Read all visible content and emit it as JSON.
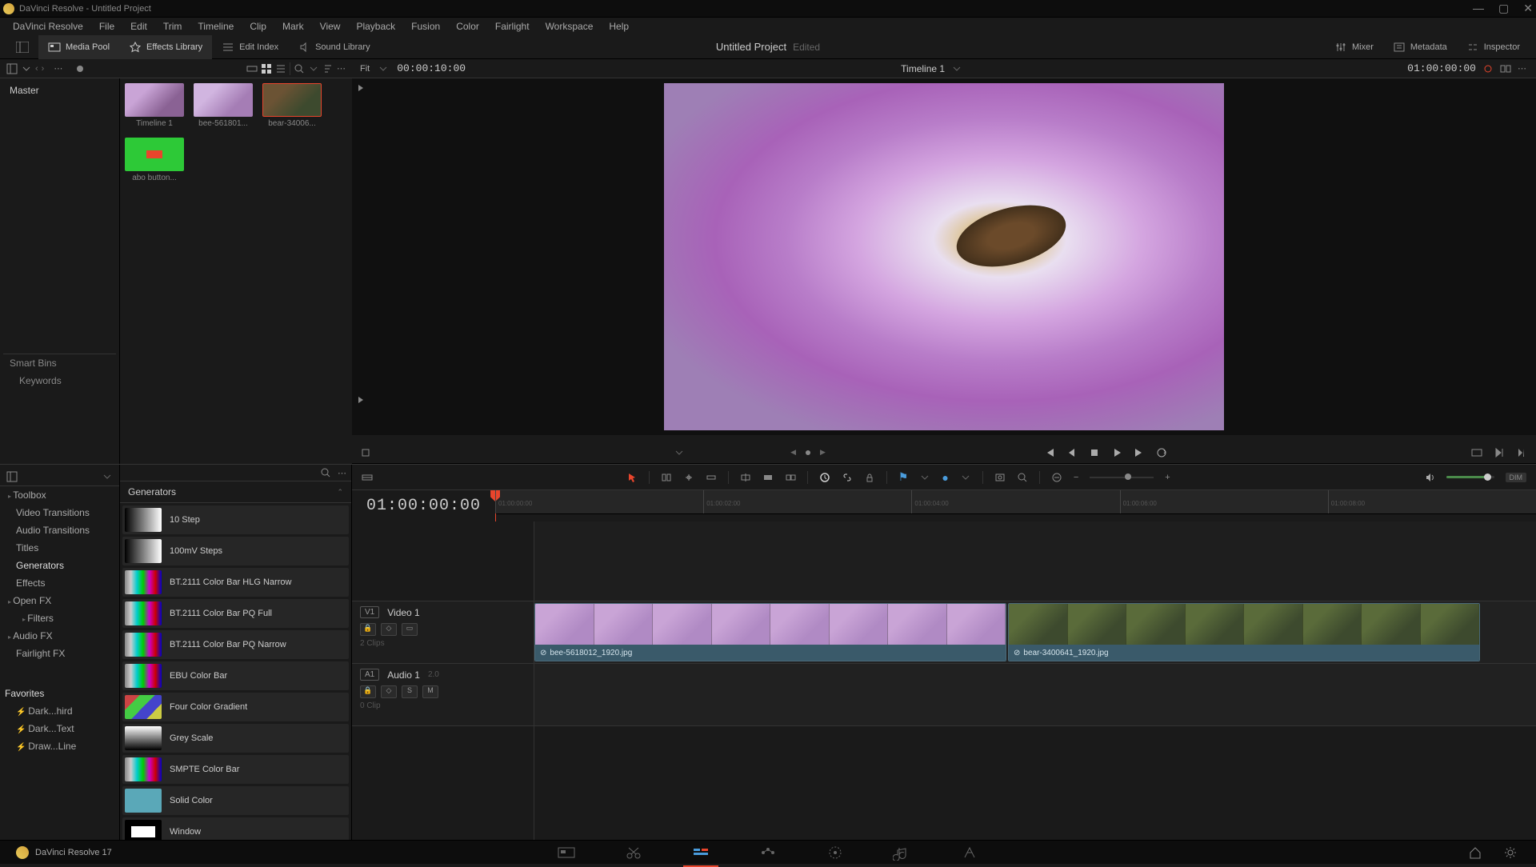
{
  "titlebar": {
    "title": "DaVinci Resolve - Untitled Project"
  },
  "menu": [
    "DaVinci Resolve",
    "File",
    "Edit",
    "Trim",
    "Timeline",
    "Clip",
    "Mark",
    "View",
    "Playback",
    "Fusion",
    "Color",
    "Fairlight",
    "Workspace",
    "Help"
  ],
  "workspace": {
    "media_pool": "Media Pool",
    "effects_lib": "Effects Library",
    "edit_index": "Edit Index",
    "sound_lib": "Sound Library",
    "mixer": "Mixer",
    "metadata": "Metadata",
    "inspector": "Inspector",
    "project_title": "Untitled Project",
    "project_status": "Edited"
  },
  "subtoolbar": {
    "fit": "Fit",
    "left_tc": "00:00:10:00",
    "timeline_name": "Timeline 1",
    "right_tc": "01:00:00:00"
  },
  "bins": {
    "master": "Master",
    "smart_bins": "Smart Bins",
    "keywords": "Keywords"
  },
  "clips": [
    {
      "label": "Timeline 1",
      "class": "t1"
    },
    {
      "label": "bee-561801...",
      "class": "t2"
    },
    {
      "label": "bear-34006...",
      "class": "t3",
      "selected": true
    },
    {
      "label": "abo button...",
      "class": "green"
    }
  ],
  "toolbox": {
    "title": "Toolbox",
    "items": [
      "Video Transitions",
      "Audio Transitions",
      "Titles",
      "Generators",
      "Effects"
    ],
    "selected": "Generators",
    "openfx": "Open FX",
    "filters": "Filters",
    "audiofx": "Audio FX",
    "fairlightfx": "Fairlight FX",
    "favorites": "Favorites",
    "fav_items": [
      "Dark...hird",
      "Dark...Text",
      "Draw...Line"
    ]
  },
  "generators": {
    "title": "Generators",
    "items": [
      {
        "label": "10 Step",
        "swatch": "sw-grad1"
      },
      {
        "label": "100mV Steps",
        "swatch": "sw-grad2"
      },
      {
        "label": "BT.2111 Color Bar HLG Narrow",
        "swatch": "sw-bars"
      },
      {
        "label": "BT.2111 Color Bar PQ Full",
        "swatch": "sw-bars"
      },
      {
        "label": "BT.2111 Color Bar PQ Narrow",
        "swatch": "sw-bars"
      },
      {
        "label": "EBU Color Bar",
        "swatch": "sw-bars"
      },
      {
        "label": "Four Color Gradient",
        "swatch": "sw-4col"
      },
      {
        "label": "Grey Scale",
        "swatch": "sw-grey"
      },
      {
        "label": "SMPTE Color Bar",
        "swatch": "sw-bars"
      },
      {
        "label": "Solid Color",
        "swatch": "sw-solid"
      },
      {
        "label": "Window",
        "swatch": "sw-window"
      }
    ]
  },
  "timeline": {
    "main_tc": "01:00:00:00",
    "v1_badge": "V1",
    "v1_name": "Video 1",
    "v1_meta": "2 Clips",
    "a1_badge": "A1",
    "a1_name": "Audio 1",
    "a1_ch": "2.0",
    "a1_meta": "0 Clip",
    "s_btn": "S",
    "m_btn": "M",
    "clip1_name": "bee-5618012_1920.jpg",
    "clip2_name": "bear-3400641_1920.jpg",
    "dim": "DIM",
    "ruler_labels": [
      "01:00:00:00",
      "01:00:02:00",
      "01:00:04:00",
      "01:00:06:00",
      "01:00:08:00"
    ]
  },
  "bottombar": {
    "app": "DaVinci Resolve 17"
  }
}
